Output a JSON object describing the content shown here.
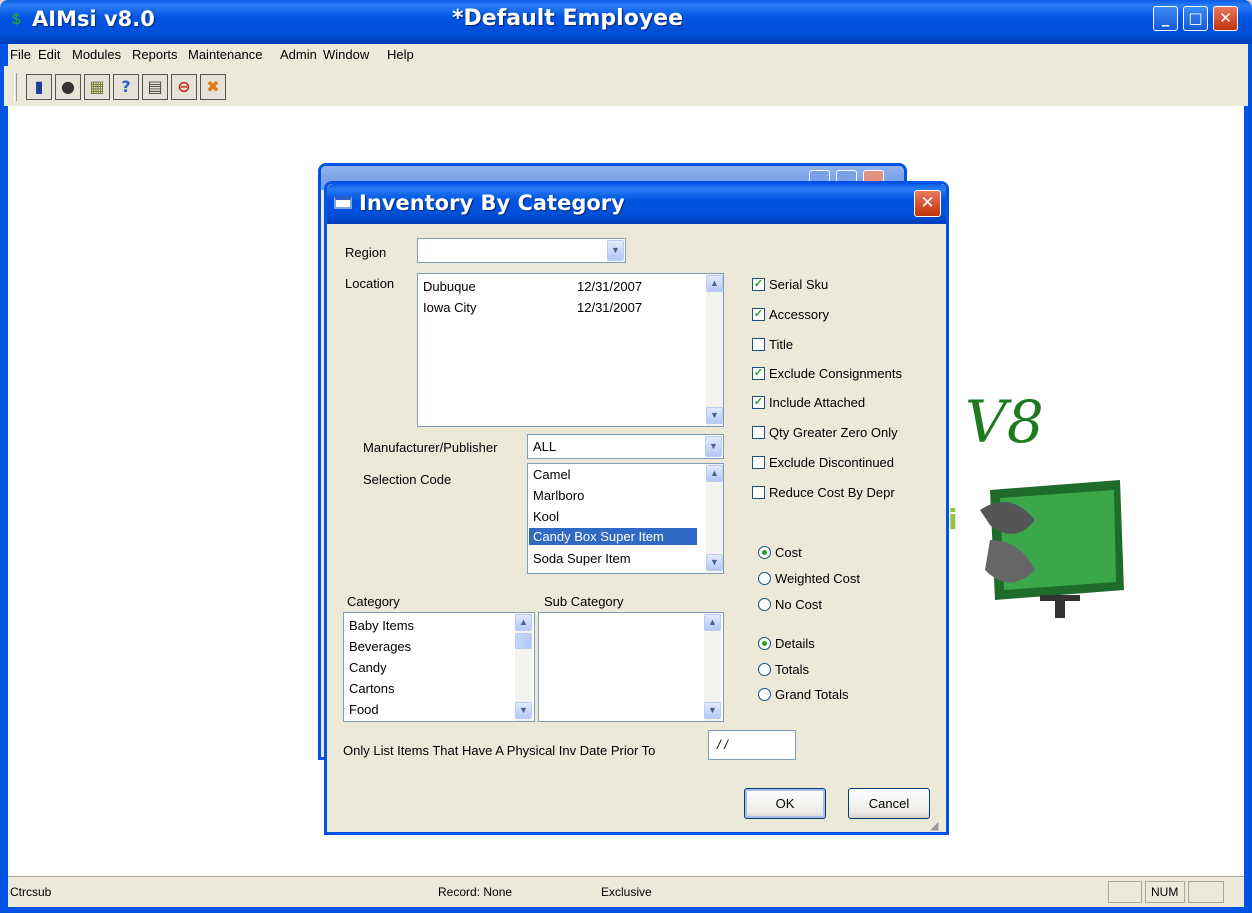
{
  "window": {
    "app_title": "AIMsi v8.0",
    "document_title": "*Default Employee",
    "minimize": "_",
    "maximize": "□",
    "close": "✕"
  },
  "menu": [
    "File",
    "Edit",
    "Modules",
    "Reports",
    "Maintenance",
    "Admin",
    "Window",
    "Help"
  ],
  "toolbar_icons": [
    "new-document-icon",
    "bomb-icon",
    "picture-icon",
    "help-icon",
    "printer-icon",
    "stop-icon",
    "exit-icon"
  ],
  "background_logo": {
    "text": "V8",
    "accent_letter": "i"
  },
  "dialog": {
    "title": "Inventory By Category",
    "region_label": "Region",
    "region_value": "",
    "location_label": "Location",
    "locations": [
      {
        "name": "Dubuque",
        "date": "12/31/2007"
      },
      {
        "name": "Iowa City",
        "date": "12/31/2007"
      }
    ],
    "manufacturer_label": "Manufacturer/Publisher",
    "manufacturer_value": "ALL",
    "selection_code_label": "Selection Code",
    "selection_codes": [
      "Camel",
      "Marlboro",
      "Kool",
      "Candy Box Super Item",
      "Soda Super Item"
    ],
    "selected_selection_code": "Candy Box Super Item",
    "category_label": "Category",
    "categories": [
      "Baby Items",
      "Beverages",
      "Candy",
      "Cartons",
      "Food"
    ],
    "sub_category_label": "Sub Category",
    "checkboxes": [
      {
        "label": "Serial Sku",
        "checked": true
      },
      {
        "label": "Accessory",
        "checked": true
      },
      {
        "label": "Title",
        "checked": false
      },
      {
        "label": "Exclude Consignments",
        "checked": true
      },
      {
        "label": "Include Attached",
        "checked": true
      },
      {
        "label": "Qty Greater Zero Only",
        "checked": false
      },
      {
        "label": "Exclude Discontinued",
        "checked": false
      },
      {
        "label": "Reduce Cost By Depr",
        "checked": false
      }
    ],
    "cost_options": [
      {
        "label": "Cost",
        "selected": true
      },
      {
        "label": "Weighted Cost",
        "selected": false
      },
      {
        "label": "No Cost",
        "selected": false
      }
    ],
    "detail_options": [
      {
        "label": "Details",
        "selected": true
      },
      {
        "label": "Totals",
        "selected": false
      },
      {
        "label": "Grand Totals",
        "selected": false
      }
    ],
    "physical_date_label": "Only List Items That Have A Physical Inv Date Prior To",
    "physical_date_value": "/ /",
    "ok_label": "OK",
    "cancel_label": "Cancel"
  },
  "status": {
    "left": "Ctrcsub",
    "record": "Record: None",
    "mode": "Exclusive",
    "num": "NUM"
  },
  "colors": {
    "xp_blue": "#0054e3",
    "dialog_bg": "#ece9d8",
    "selection": "#316ac5",
    "check_green": "#21a121"
  }
}
